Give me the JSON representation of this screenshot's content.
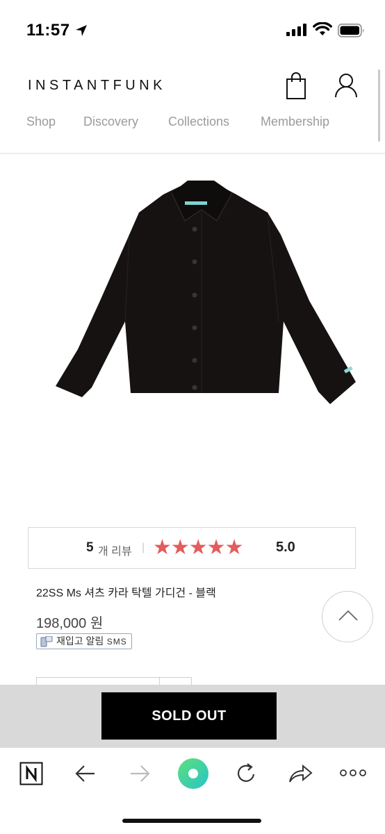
{
  "status_bar": {
    "time": "11:57"
  },
  "header": {
    "brand": "INSTANTFUNK",
    "nav": [
      "Shop",
      "Discovery",
      "Collections",
      "Membership"
    ]
  },
  "product": {
    "review_count": "5",
    "review_label": "개 리뷰",
    "review_separator": "|",
    "stars": "★★★★★",
    "rating": "5.0",
    "title": "22SS Ms 셔츠 카라 탁텔 가디건 - 블랙",
    "price": "198,000 원",
    "restock_label": "재입고 알림",
    "restock_sms": "SMS",
    "sold_out_label": "SOLD OUT"
  },
  "colors": {
    "star": "#e45c5c",
    "nav_text": "#9b9b9b",
    "sold_out_bg": "#000000",
    "sold_out_bar": "#d9d9d9",
    "browser_green": "#3dd6a0"
  },
  "toolbar_icons": [
    "naver-icon",
    "back-arrow-icon",
    "forward-arrow-icon",
    "green-dot-icon",
    "reload-icon",
    "share-icon",
    "more-icon"
  ]
}
